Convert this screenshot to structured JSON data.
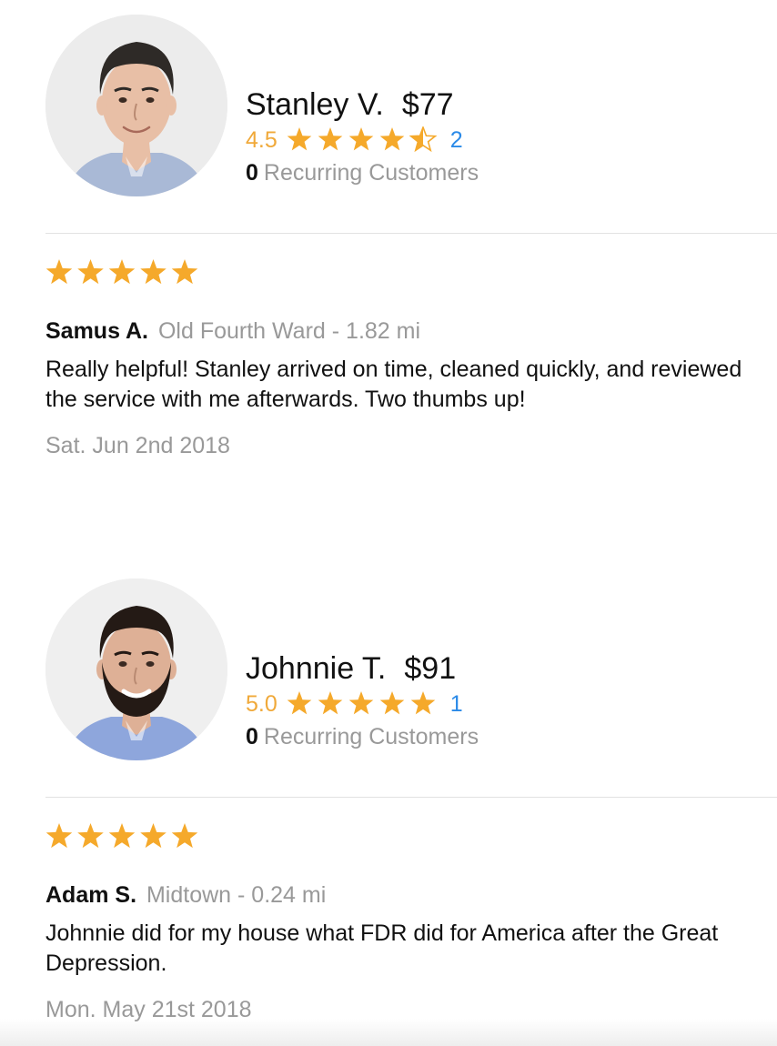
{
  "pros": [
    {
      "name": "Stanley V.",
      "price": "$77",
      "rating": "4.5",
      "rating_fraction": 0.9,
      "review_count": "2",
      "recurring_count": "0",
      "recurring_label": "Recurring Customers",
      "avatar": {
        "icon": "person-photo",
        "hair": "#2e2a27",
        "shirt": "#a9b9d6",
        "skin": "#e8bfa6",
        "bg": "#ececec",
        "beard": false
      },
      "review": {
        "stars": 5,
        "reviewer": "Samus A.",
        "location": "Old Fourth Ward - 1.82 mi",
        "text": "Really helpful! Stanley arrived on time, cleaned quickly, and reviewed the service with me afterwards. Two thumbs up!",
        "date": "Sat. Jun 2nd 2018"
      }
    },
    {
      "name": "Johnnie T.",
      "price": "$91",
      "rating": "5.0",
      "rating_fraction": 1.0,
      "review_count": "1",
      "recurring_count": "0",
      "recurring_label": "Recurring Customers",
      "avatar": {
        "icon": "person-photo",
        "hair": "#241a15",
        "shirt": "#8ea6dc",
        "skin": "#deb096",
        "bg": "#efefef",
        "beard": true
      },
      "review": {
        "stars": 5,
        "reviewer": "Adam S.",
        "location": "Midtown - 0.24 mi",
        "text": "Johnnie did for my house what FDR did for America after the Great Depression.",
        "date": "Mon. May 21st 2018"
      }
    }
  ],
  "colors": {
    "star": "#f5a92b",
    "star_empty": "#f5a92b",
    "rating_text": "#f0a93a",
    "link_blue": "#2a8ae8",
    "muted": "#999999"
  }
}
